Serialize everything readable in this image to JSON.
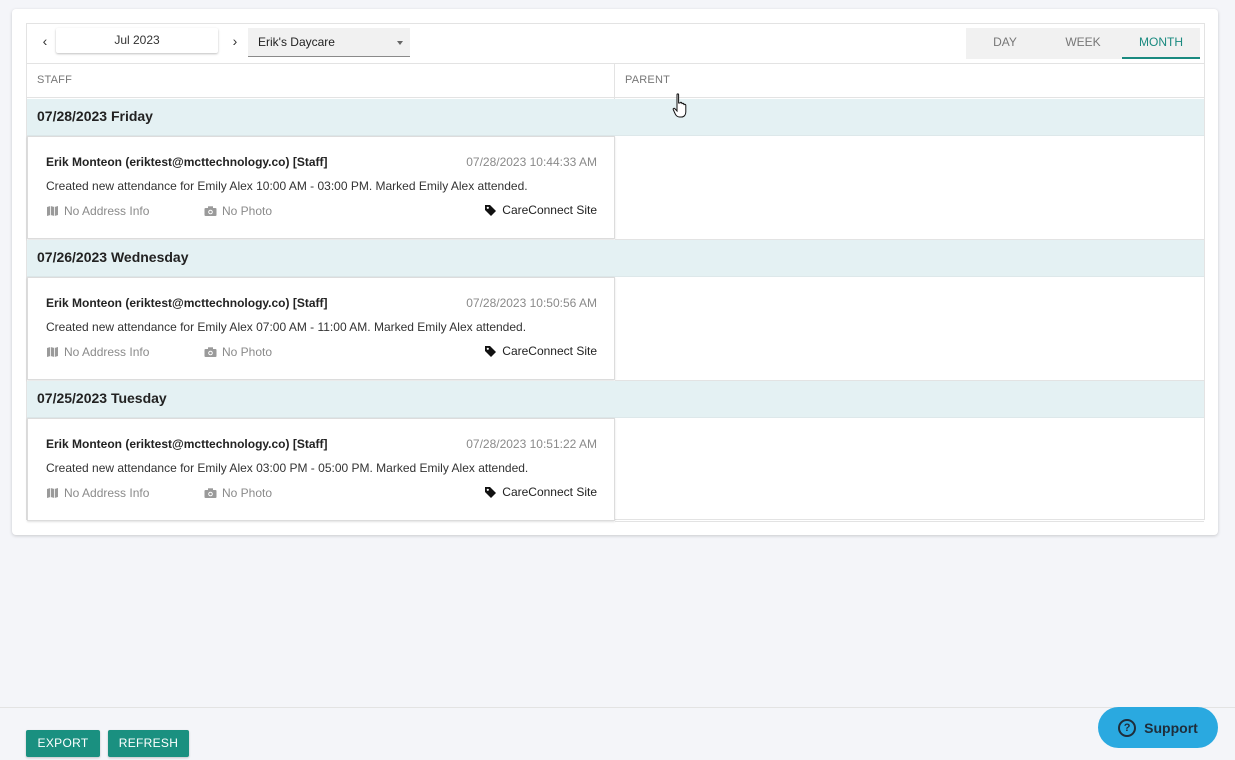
{
  "toolbar": {
    "prev_icon": "chevron-left-icon",
    "next_icon": "chevron-right-icon",
    "month": "Jul 2023",
    "site": "Erik's Daycare",
    "tabs": [
      "DAY",
      "WEEK",
      "MONTH"
    ],
    "active_tab": "MONTH"
  },
  "columns": {
    "staff": "STAFF",
    "parent": "PARENT"
  },
  "days": [
    {
      "date": "07/28/2023 Friday",
      "entries": [
        {
          "user": "Erik Monteon (eriktest@mcttechnology.co) [Staff]",
          "time": "07/28/2023 10:44:33 AM",
          "message": "Created new attendance for Emily Alex 10:00 AM - 03:00 PM. Marked Emily Alex attended.",
          "address": "No Address Info",
          "photo": "No Photo",
          "site": "CareConnect Site"
        }
      ]
    },
    {
      "date": "07/26/2023 Wednesday",
      "entries": [
        {
          "user": "Erik Monteon (eriktest@mcttechnology.co) [Staff]",
          "time": "07/28/2023 10:50:56 AM",
          "message": "Created new attendance for Emily Alex 07:00 AM - 11:00 AM. Marked Emily Alex attended.",
          "address": "No Address Info",
          "photo": "No Photo",
          "site": "CareConnect Site"
        }
      ]
    },
    {
      "date": "07/25/2023 Tuesday",
      "entries": [
        {
          "user": "Erik Monteon (eriktest@mcttechnology.co) [Staff]",
          "time": "07/28/2023 10:51:22 AM",
          "message": "Created new attendance for Emily Alex 03:00 PM - 05:00 PM. Marked Emily Alex attended.",
          "address": "No Address Info",
          "photo": "No Photo",
          "site": "CareConnect Site"
        }
      ]
    }
  ],
  "footer": {
    "export": "EXPORT",
    "refresh": "REFRESH",
    "support": "Support"
  },
  "colors": {
    "accent": "#1a9080",
    "day_header_bg": "#e4f1f3",
    "support_bg": "#2aa9e0"
  }
}
